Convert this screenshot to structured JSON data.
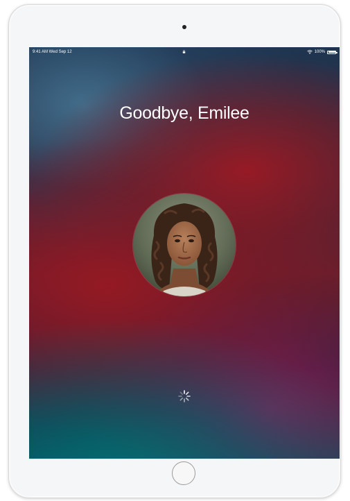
{
  "status_bar": {
    "time": "9:41 AM  Wed Sep 12",
    "battery_percent": "100%",
    "battery_level": 1.0,
    "icons": [
      "lock-icon",
      "wifi-icon",
      "battery-icon"
    ]
  },
  "lock_screen": {
    "greeting": "Goodbye, Emilee",
    "avatar_icon": "user-avatar",
    "activity": "loading-spinner-icon"
  },
  "device": {
    "hardware": [
      "front-camera",
      "home-button"
    ],
    "bezel_color": "#f5f6f8"
  }
}
